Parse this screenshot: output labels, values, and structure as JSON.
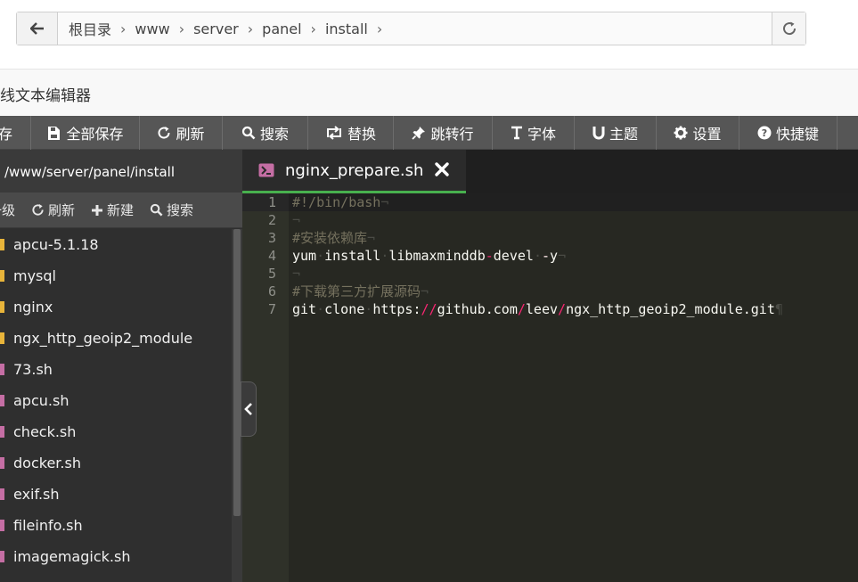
{
  "pathbar": {
    "crumbs": [
      "根目录",
      "www",
      "server",
      "panel",
      "install"
    ]
  },
  "title": "在线文本编辑器",
  "toolbar": {
    "items": [
      {
        "icon": "save-icon",
        "label": "保存"
      },
      {
        "icon": "save-all-icon",
        "label": "全部保存"
      },
      {
        "icon": "refresh-icon",
        "label": "刷新"
      },
      {
        "icon": "search-icon",
        "label": "搜索"
      },
      {
        "icon": "replace-icon",
        "label": "替换"
      },
      {
        "icon": "pin-icon",
        "label": "跳转行"
      },
      {
        "icon": "font-icon",
        "label": "字体"
      },
      {
        "icon": "magnet-icon",
        "label": "主题"
      },
      {
        "icon": "gear-icon",
        "label": "设置"
      },
      {
        "icon": "question-icon",
        "label": "快捷键"
      }
    ]
  },
  "sidebar": {
    "path": "/www/server/panel/install",
    "actions": {
      "up": "上一级",
      "refresh": "刷新",
      "new": "新建",
      "search": "搜索"
    },
    "items": [
      {
        "type": "folder",
        "name": "apcu-5.1.18"
      },
      {
        "type": "folder",
        "name": "mysql"
      },
      {
        "type": "folder",
        "name": "nginx"
      },
      {
        "type": "folder",
        "name": "ngx_http_geoip2_module"
      },
      {
        "type": "file",
        "name": "73.sh"
      },
      {
        "type": "file",
        "name": "apcu.sh"
      },
      {
        "type": "file",
        "name": "check.sh"
      },
      {
        "type": "file",
        "name": "docker.sh"
      },
      {
        "type": "file",
        "name": "exif.sh"
      },
      {
        "type": "file",
        "name": "fileinfo.sh"
      },
      {
        "type": "file",
        "name": "imagemagick.sh"
      }
    ]
  },
  "editor": {
    "tab": {
      "name": "nginx_prepare.sh"
    },
    "line_numbers": [
      "1",
      "2",
      "3",
      "4",
      "5",
      "6",
      "7"
    ],
    "lines": {
      "l1": "#!/bin/bash",
      "l3": "#安装依赖库",
      "l4": {
        "a": "yum",
        "b": "install",
        "c": "libmaxminddb",
        "d": "devel",
        "e": "-y"
      },
      "l6": "#下载第三方扩展源码",
      "l7": {
        "a": "git",
        "b": "clone",
        "c": "https:",
        "d": "//",
        "e": "github.com",
        "f": "/",
        "g": "leev",
        "h": "/",
        "i": "ngx_http_geoip2_module.git"
      }
    }
  },
  "colors": {
    "toolbar_bg": "#565656",
    "sidebar_bg": "#2f2f2f",
    "editor_bg": "#272822",
    "tab_underline": "#48b04e",
    "folder_marker": "#e8b43a",
    "file_marker": "#c56ea4",
    "comment": "#75715e",
    "operator": "#f92672"
  }
}
